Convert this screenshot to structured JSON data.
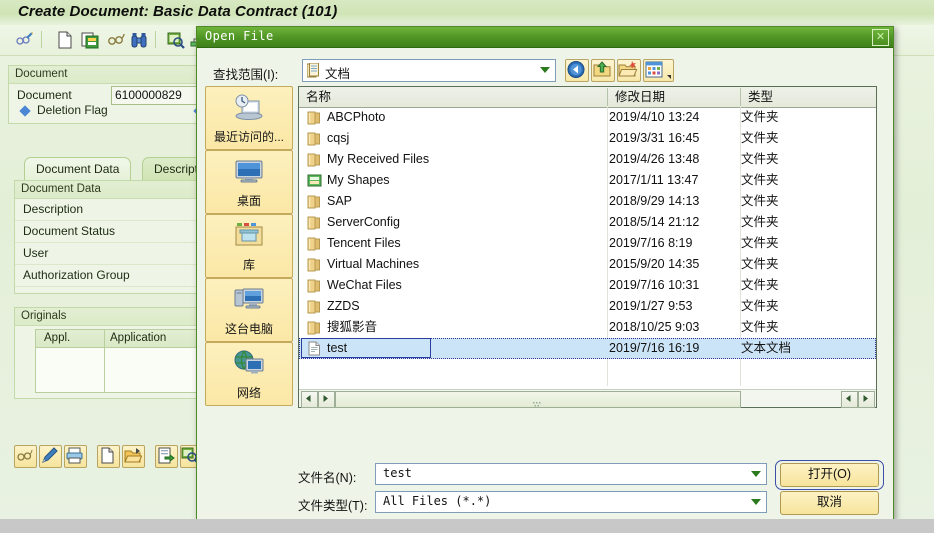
{
  "sap": {
    "title": "Create Document: Basic Data Contract (101)",
    "toolbar_icons": [
      "glasses-pencil-icon",
      "new-document-icon",
      "copy-document-icon",
      "glasses-icon",
      "binoculars-icon",
      "find-next-icon",
      "hierarchy-icon"
    ],
    "document_panel": {
      "header": "Document",
      "field_label": "Document",
      "field_value": "6100000829",
      "deletion_flag_label": "Deletion Flag"
    },
    "tabs": [
      {
        "label": "Document Data",
        "selected": true
      },
      {
        "label": "Descript",
        "selected": false
      }
    ],
    "document_data_panel": {
      "header": "Document Data",
      "rows": [
        "Description",
        "Document Status",
        "User",
        "Authorization Group"
      ]
    },
    "originals_panel": {
      "header": "Originals",
      "columns": [
        "Appl.",
        "Application"
      ]
    },
    "action_icons": [
      "glasses-icon",
      "pencil-icon",
      "print-icon",
      "new-file-icon",
      "open-folder-icon",
      "import-icon",
      "search-file-icon"
    ]
  },
  "dialog": {
    "title": "Open File",
    "close_label": "✕",
    "lookin": {
      "label": "查找范围(I):",
      "value": "文档",
      "icon": "documents-folder-icon"
    },
    "nav_buttons": [
      {
        "name": "back-button",
        "icon": "back-arrow-icon"
      },
      {
        "name": "up-one-level-button",
        "icon": "up-arrow-folder-icon"
      },
      {
        "name": "create-new-folder-button",
        "icon": "new-folder-icon"
      },
      {
        "name": "views-button",
        "icon": "views-grid-icon"
      }
    ],
    "places": [
      {
        "label": "最近访问的...",
        "icon": "recent-places-icon"
      },
      {
        "label": "桌面",
        "icon": "desktop-icon"
      },
      {
        "label": "库",
        "icon": "libraries-icon"
      },
      {
        "label": "这台电脑",
        "icon": "this-pc-icon"
      },
      {
        "label": "网络",
        "icon": "network-icon"
      }
    ],
    "columns": [
      "名称",
      "修改日期",
      "类型"
    ],
    "files": [
      {
        "name": "ABCPhoto",
        "date": "2019/4/10 13:24",
        "type": "文件夹",
        "icon": "folder-icon",
        "selected": false
      },
      {
        "name": "cqsj",
        "date": "2019/3/31 16:45",
        "type": "文件夹",
        "icon": "folder-icon",
        "selected": false
      },
      {
        "name": "My Received Files",
        "date": "2019/4/26 13:48",
        "type": "文件夹",
        "icon": "folder-icon",
        "selected": false
      },
      {
        "name": "My Shapes",
        "date": "2017/1/11 13:47",
        "type": "文件夹",
        "icon": "shapes-folder-icon",
        "selected": false
      },
      {
        "name": "SAP",
        "date": "2018/9/29 14:13",
        "type": "文件夹",
        "icon": "folder-icon",
        "selected": false
      },
      {
        "name": "ServerConfig",
        "date": "2018/5/14 21:12",
        "type": "文件夹",
        "icon": "folder-icon",
        "selected": false
      },
      {
        "name": "Tencent Files",
        "date": "2019/7/16 8:19",
        "type": "文件夹",
        "icon": "folder-icon",
        "selected": false
      },
      {
        "name": "Virtual Machines",
        "date": "2015/9/20 14:35",
        "type": "文件夹",
        "icon": "folder-icon",
        "selected": false
      },
      {
        "name": "WeChat Files",
        "date": "2019/7/16 10:31",
        "type": "文件夹",
        "icon": "folder-icon",
        "selected": false
      },
      {
        "name": "ZZDS",
        "date": "2019/1/27 9:53",
        "type": "文件夹",
        "icon": "folder-icon",
        "selected": false
      },
      {
        "name": "搜狐影音",
        "date": "2018/10/25 9:03",
        "type": "文件夹",
        "icon": "folder-icon",
        "selected": false
      },
      {
        "name": "test",
        "date": "2019/7/16 16:19",
        "type": "文本文档",
        "icon": "text-file-icon",
        "selected": true
      }
    ],
    "filename": {
      "label": "文件名(N):",
      "value": "test"
    },
    "filetype": {
      "label": "文件类型(T):",
      "value": "All Files (*.*)"
    },
    "buttons": {
      "open": "打开(O)",
      "cancel": "取消"
    }
  },
  "colors": {
    "dialog_title_green": "#4e9424",
    "selection_blue": "#cce4f7",
    "sap_green": "#e4efd8",
    "button_yellow": "#f7e49b"
  }
}
